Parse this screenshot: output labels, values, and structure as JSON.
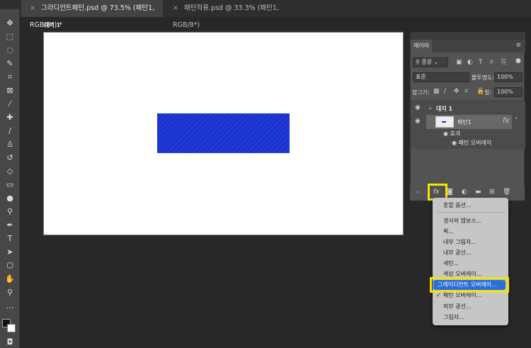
{
  "tabs": [
    {
      "label": "그라디언트패턴.psd @ 73.5% (패턴1, RGB/8*) *",
      "active": true
    },
    {
      "label": "패턴적용.psd @ 33.3% (패턴1, RGB/8*)",
      "active": false
    }
  ],
  "artboard_label": "대지 1",
  "layers_panel": {
    "tab": "레이어",
    "filter": "종류",
    "blend_mode": "표준",
    "opacity_label": "불투명도:",
    "opacity": "100%",
    "lock_label": "잠그기:",
    "fill_label": "칠:",
    "fill": "100%",
    "layers": [
      {
        "name": "대지 1"
      },
      {
        "name": "패턴1",
        "fx": "fx"
      }
    ],
    "effects_label": "효과",
    "effect": "패턴 오버레이"
  },
  "fx_button": "fx",
  "menu": {
    "items": [
      "혼합 옵션...",
      "경사와 엠보스...",
      "획...",
      "내부 그림자...",
      "내부 광선...",
      "새틴...",
      "색상 오버레이...",
      "그레이디언트 오버레이...",
      "패턴 오버레이...",
      "외부 광선...",
      "그림자..."
    ],
    "checkmark": "✓"
  },
  "colors": {
    "highlight": "#f5e400",
    "selected": "#2a6fd6",
    "pattern": "#1a33cc"
  }
}
